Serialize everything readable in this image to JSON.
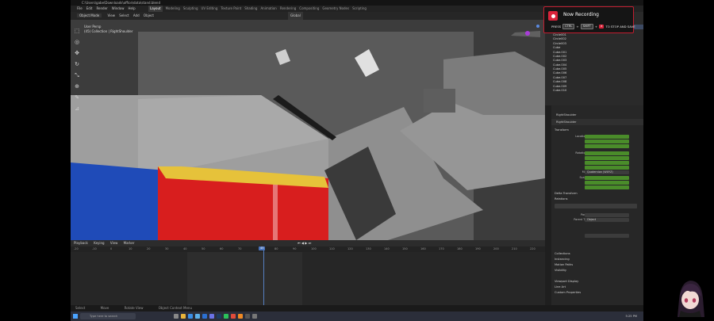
{
  "window": {
    "title": "C:\\Users\\gabe\\Downloads\\office\\data\\stand.blend"
  },
  "menu": {
    "items": [
      "File",
      "Edit",
      "Render",
      "Window",
      "Help"
    ]
  },
  "workspaces": {
    "items": [
      "Layout",
      "Modeling",
      "Sculpting",
      "UV Editing",
      "Texture Paint",
      "Shading",
      "Animation",
      "Rendering",
      "Compositing",
      "Geometry Nodes",
      "Scripting"
    ],
    "active": "Layout"
  },
  "viewport": {
    "mode": "Object Mode",
    "header_items": [
      "View",
      "Select",
      "Add",
      "Object"
    ],
    "overlay_label": "Global",
    "info_line1": "User Persp",
    "info_line2": "(45) Collection | RightShoulder"
  },
  "recording": {
    "title": "Now Recording",
    "press_label": "PRESS",
    "key1": "CTRL",
    "plus1": "+",
    "key2": "SHIFT",
    "plus2": "+",
    "key3": "X",
    "suffix": "TO STOP AND SAVE",
    "accent": "#d9233a"
  },
  "outliner": {
    "rows": [
      "Scene Collection",
      "Collection",
      "Camera",
      "RightShoulder",
      "Cube",
      "Circle001",
      "Circle002",
      "Circle003",
      "Cube",
      "Cube.001",
      "Cube.002",
      "Cube.003",
      "Cube.004",
      "Cube.005",
      "Cube.006",
      "Cube.007",
      "Cube.008",
      "Cube.009",
      "Cube.010"
    ]
  },
  "properties": {
    "breadcrumb": "RightShoulder",
    "object_name": "RightShoulder",
    "transform_label": "Transform",
    "location_label": "Location X",
    "rotation_label": "Rotation X",
    "mode_label": "Mode",
    "mode_value": "Quaternion (WXYZ)",
    "scale_label": "Scale X",
    "delta_label": "Delta Transform",
    "relations_label": "Relations",
    "parent_label": "Parent",
    "parent_type_label": "Parent Type",
    "parent_type_value": "Object",
    "collections_label": "Collections",
    "instancing_label": "Instancing",
    "motion_label": "Motion Paths",
    "visibility_label": "Visibility",
    "viewport_display_label": "Viewport Display",
    "line_art_label": "Line Art",
    "custom_props_label": "Custom Properties"
  },
  "timeline": {
    "header_items": [
      "Playback",
      "Keying",
      "View",
      "Marker"
    ],
    "ruler": [
      "-20",
      "-10",
      "0",
      "10",
      "20",
      "30",
      "40",
      "50",
      "60",
      "70",
      "80",
      "90",
      "100",
      "110",
      "120",
      "130",
      "140",
      "150",
      "160",
      "170",
      "180",
      "190",
      "200",
      "210",
      "220",
      "230"
    ],
    "current_frame": "45"
  },
  "status": {
    "left": "Select",
    "mid": "Move",
    "right": "Rotate View",
    "context": "Object Context Menu"
  },
  "taskbar": {
    "search_placeholder": "Type here to search",
    "time": "5:25 PM"
  }
}
